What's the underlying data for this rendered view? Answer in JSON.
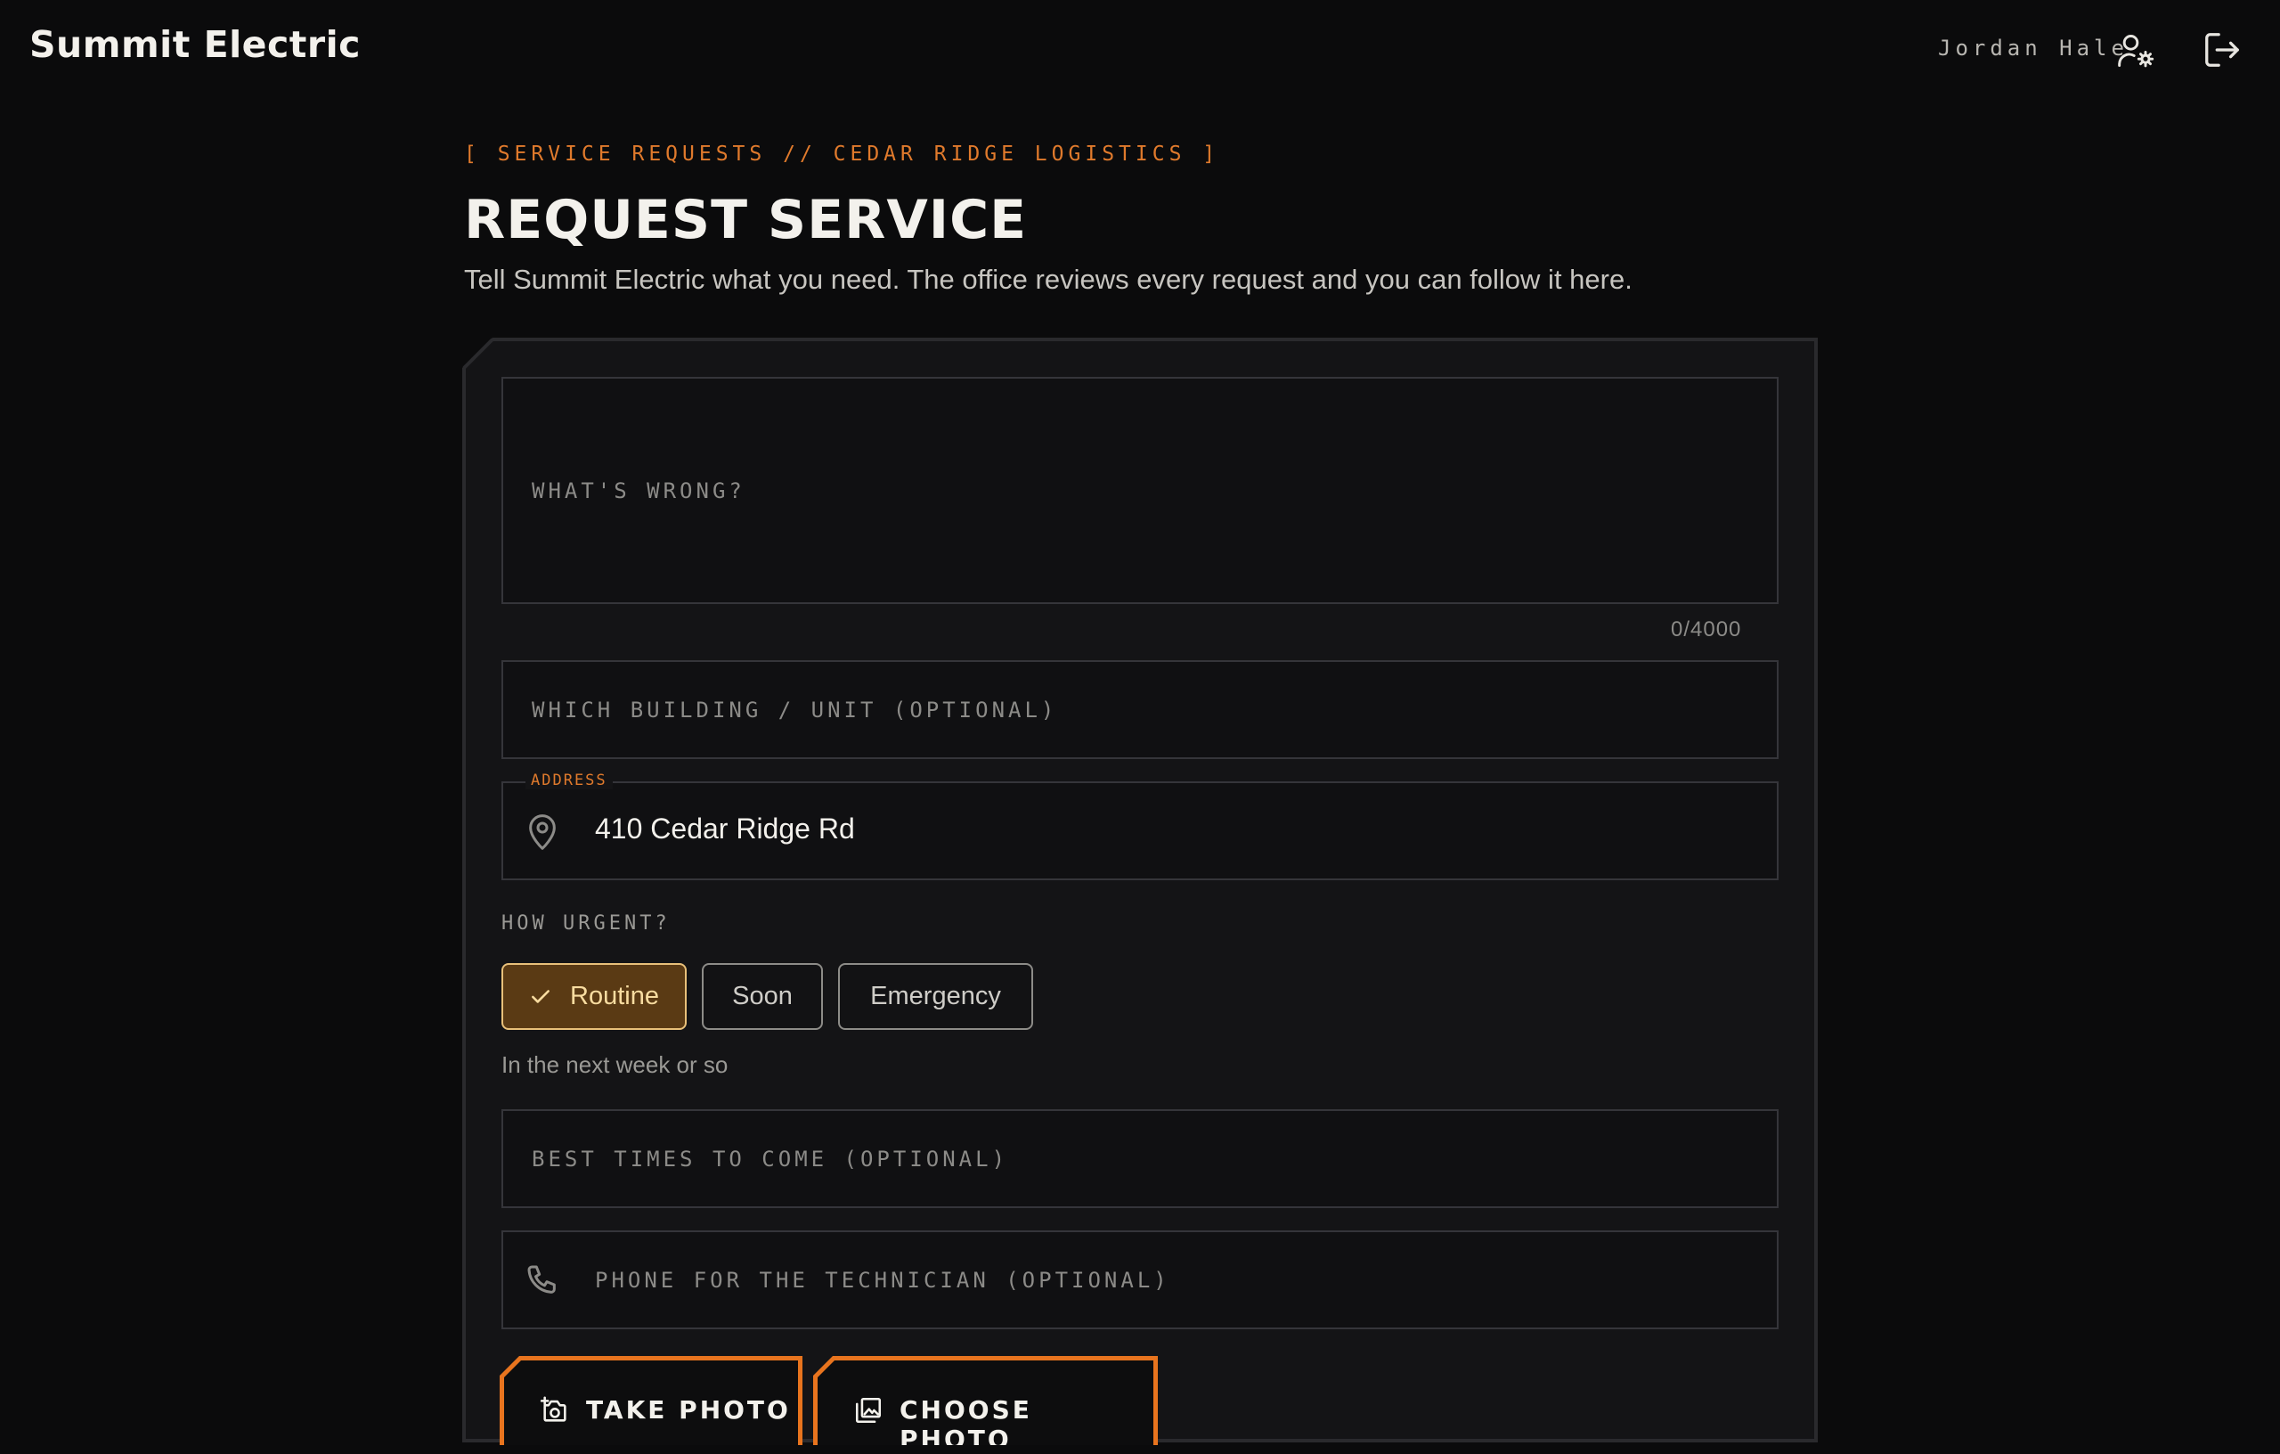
{
  "header": {
    "brand": "Summit Electric",
    "user_name": "Jordan Hale",
    "account_settings_icon": "user-gear-icon",
    "logout_icon": "logout-icon"
  },
  "page": {
    "kicker": "[ SERVICE REQUESTS // CEDAR RIDGE LOGISTICS ]",
    "title": "REQUEST SERVICE",
    "subtitle": "Tell Summit Electric what you need. The office reviews every request and you can follow it here."
  },
  "form": {
    "description": {
      "placeholder": "WHAT'S WRONG?",
      "value": "",
      "counter": "0/4000"
    },
    "building": {
      "placeholder": "WHICH BUILDING / UNIT (OPTIONAL)",
      "value": ""
    },
    "address": {
      "label": "ADDRESS",
      "value": "410 Cedar Ridge Rd",
      "icon": "map-pin-icon"
    },
    "urgency": {
      "label": "HOW URGENT?",
      "options": [
        "Routine",
        "Soon",
        "Emergency"
      ],
      "selected": "Routine",
      "hint": "In the next week or so"
    },
    "best_times": {
      "placeholder": "BEST TIMES TO COME (OPTIONAL)",
      "value": ""
    },
    "phone": {
      "placeholder": "PHONE FOR THE TECHNICIAN (OPTIONAL)",
      "value": "",
      "icon": "phone-icon"
    },
    "photos": {
      "take_label": "TAKE PHOTO",
      "choose_label": "CHOOSE PHOTO"
    }
  },
  "colors": {
    "background": "#0b0b0c",
    "accent": "#e8741e",
    "selected_chip": "#5a3a14"
  }
}
